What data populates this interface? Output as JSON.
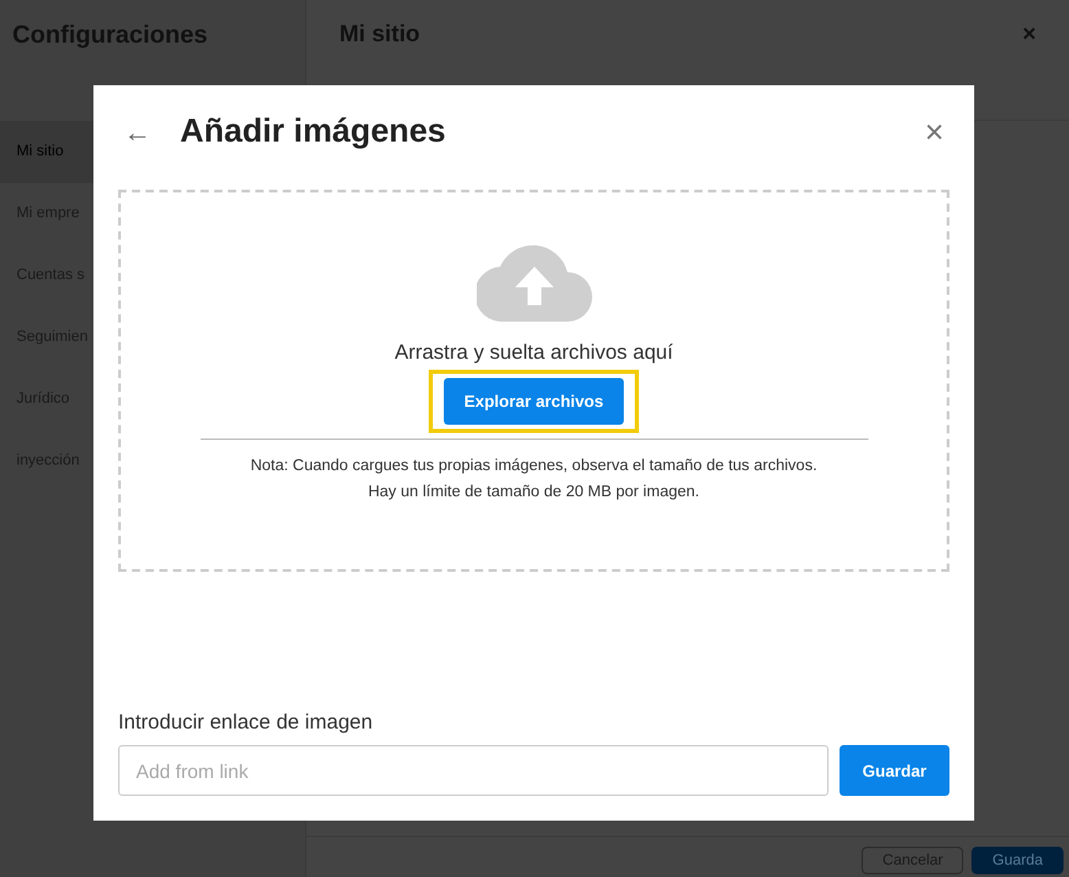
{
  "background": {
    "sidebar_title": "Configuraciones",
    "sidebar_items": [
      {
        "label": "Mi sitio",
        "selected": true
      },
      {
        "label": "Mi empre",
        "selected": false
      },
      {
        "label": "Cuentas s",
        "selected": false
      },
      {
        "label": "Seguimien",
        "selected": false
      },
      {
        "label": "Jurídico",
        "selected": false
      },
      {
        "label": "inyección",
        "selected": false
      }
    ],
    "page_title": "Mi sitio",
    "close": "×",
    "buttons": [
      {
        "label": "Cancelar",
        "kind": "secondary"
      },
      {
        "label": "Guarda",
        "kind": "primary"
      }
    ]
  },
  "dialog": {
    "title": "Añadir imágenes",
    "back": "←",
    "close": "×",
    "dropzone": {
      "text": "Arrastra y suelta archivos aquí",
      "button": {
        "label": "Explorar archivos",
        "highlighted": true
      },
      "note": [
        "Nota: Cuando cargues tus propias imágenes, observa el tamaño de tus archivos.",
        "Hay un límite de tamaño de 20 MB por imagen."
      ]
    },
    "link_label": "Introducir enlace de imagen",
    "link_field": {
      "placeholder": "Add from link"
    },
    "save_button": "Guardar"
  }
}
